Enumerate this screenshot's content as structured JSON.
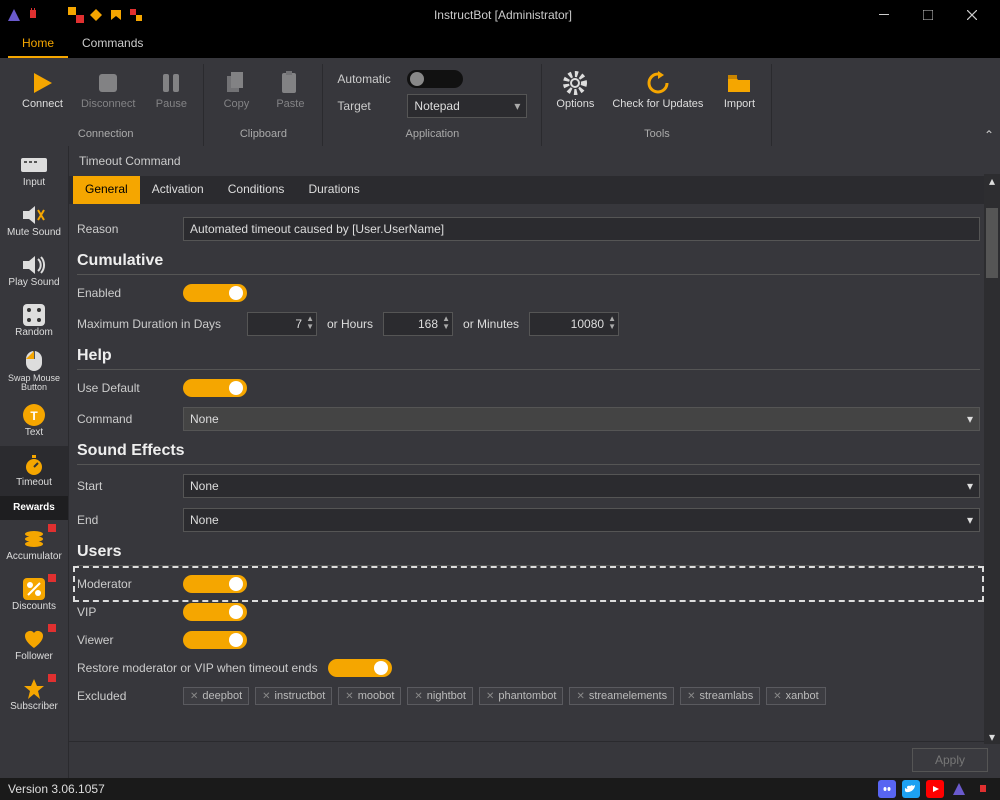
{
  "window": {
    "title": "InstructBot [Administrator]"
  },
  "tabs": {
    "home": "Home",
    "commands": "Commands"
  },
  "ribbon": {
    "connection": {
      "label": "Connection",
      "connect": "Connect",
      "disconnect": "Disconnect",
      "pause": "Pause"
    },
    "clipboard": {
      "label": "Clipboard",
      "copy": "Copy",
      "paste": "Paste"
    },
    "application": {
      "label": "Application",
      "automatic": "Automatic",
      "target": "Target",
      "target_value": "Notepad"
    },
    "tools": {
      "label": "Tools",
      "options": "Options",
      "check": "Check for Updates",
      "import": "Import"
    }
  },
  "sidebar": {
    "items": [
      {
        "label": "Input"
      },
      {
        "label": "Mute Sound"
      },
      {
        "label": "Play Sound"
      },
      {
        "label": "Random"
      },
      {
        "label": "Swap Mouse Button"
      },
      {
        "label": "Text"
      },
      {
        "label": "Timeout"
      },
      {
        "label": "Rewards"
      },
      {
        "label": "Accumulator"
      },
      {
        "label": "Discounts"
      },
      {
        "label": "Follower"
      },
      {
        "label": "Subscriber"
      }
    ]
  },
  "content": {
    "title": "Timeout Command",
    "tabs": {
      "general": "General",
      "activation": "Activation",
      "conditions": "Conditions",
      "durations": "Durations"
    },
    "reason": {
      "label": "Reason",
      "value": "Automated timeout caused by [User.UserName]"
    },
    "cumulative": {
      "title": "Cumulative",
      "enabled": "Enabled",
      "max_label": "Maximum Duration   in Days",
      "days": "7",
      "or_hours": "or Hours",
      "hours": "168",
      "or_minutes": "or Minutes",
      "minutes": "10080"
    },
    "help": {
      "title": "Help",
      "use_default": "Use Default",
      "command": "Command",
      "command_value": "None"
    },
    "sfx": {
      "title": "Sound Effects",
      "start": "Start",
      "start_value": "None",
      "end": "End",
      "end_value": "None"
    },
    "users": {
      "title": "Users",
      "moderator": "Moderator",
      "vip": "VIP",
      "viewer": "Viewer",
      "restore": "Restore moderator or VIP when timeout ends",
      "excluded": "Excluded",
      "tags": [
        "deepbot",
        "instructbot",
        "moobot",
        "nightbot",
        "phantombot",
        "streamelements",
        "streamlabs",
        "xanbot"
      ]
    }
  },
  "apply": "Apply",
  "status": {
    "version": "Version 3.06.1057"
  }
}
